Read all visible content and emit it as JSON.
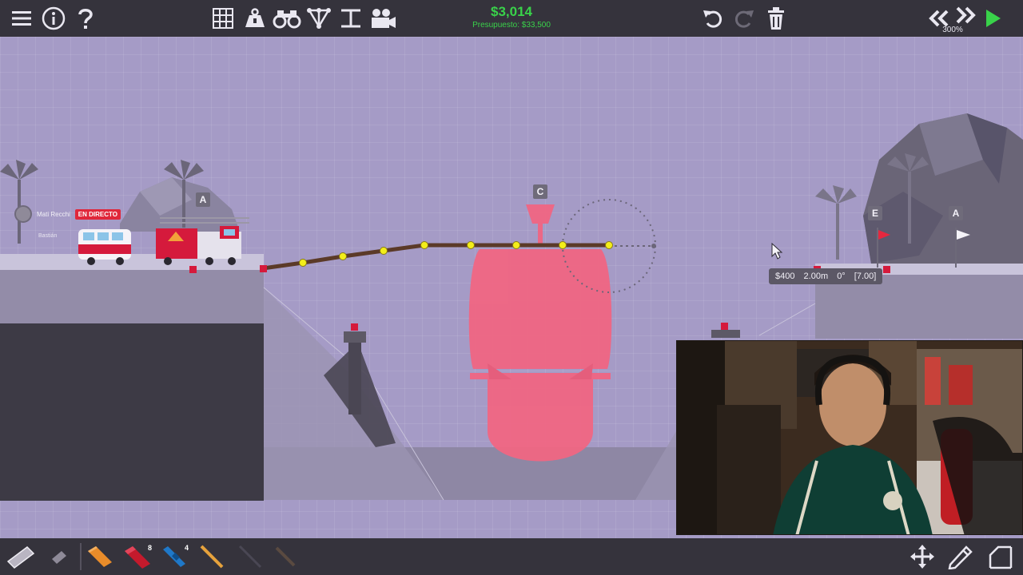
{
  "budget": {
    "cost": "$3,014",
    "limit": "Presupuesto: $33,500"
  },
  "zoom": "300%",
  "labels": {
    "anchor_left": "A",
    "center": "C",
    "flag_e": "E",
    "anchor_right": "A"
  },
  "tooltip": {
    "cost": "$400",
    "length": "2.00m",
    "angle": "0°",
    "stress": "[7.00]"
  },
  "stream_overlay": {
    "name": "Mati Recchi",
    "live": "EN DIRECTO",
    "sub": "Bastián"
  },
  "toolbar_top": {
    "left_icons": [
      "menu-icon",
      "info-icon",
      "help-icon"
    ],
    "center_icons": [
      "grid-icon",
      "anchor-weight-icon",
      "binoculars-icon",
      "joints-icon",
      "measure-icon",
      "camera-icon"
    ],
    "right_icons": [
      "undo-icon",
      "redo-icon",
      "trash-icon",
      "rewind-icon",
      "fast-forward-icon",
      "play-icon"
    ]
  },
  "toolbar_bottom": {
    "materials": [
      {
        "name": "road",
        "count": ""
      },
      {
        "name": "reinforced-road",
        "count": ""
      },
      {
        "name": "wood",
        "count": ""
      },
      {
        "name": "hydraulic",
        "count": "8"
      },
      {
        "name": "rope",
        "count": "4"
      },
      {
        "name": "steel",
        "count": ""
      },
      {
        "name": "cable",
        "count": ""
      },
      {
        "name": "spring",
        "count": ""
      }
    ],
    "right_icons": [
      "move-icon",
      "edit-icon",
      "corner-icon"
    ]
  },
  "colors": {
    "budget_green": "#39d24a",
    "anchor_red": "#d51a3c",
    "joint_yellow": "#f3ee1a",
    "ship_pink": "#f06683",
    "road_brown": "#5b3a28",
    "sky": "#a59bc6"
  }
}
